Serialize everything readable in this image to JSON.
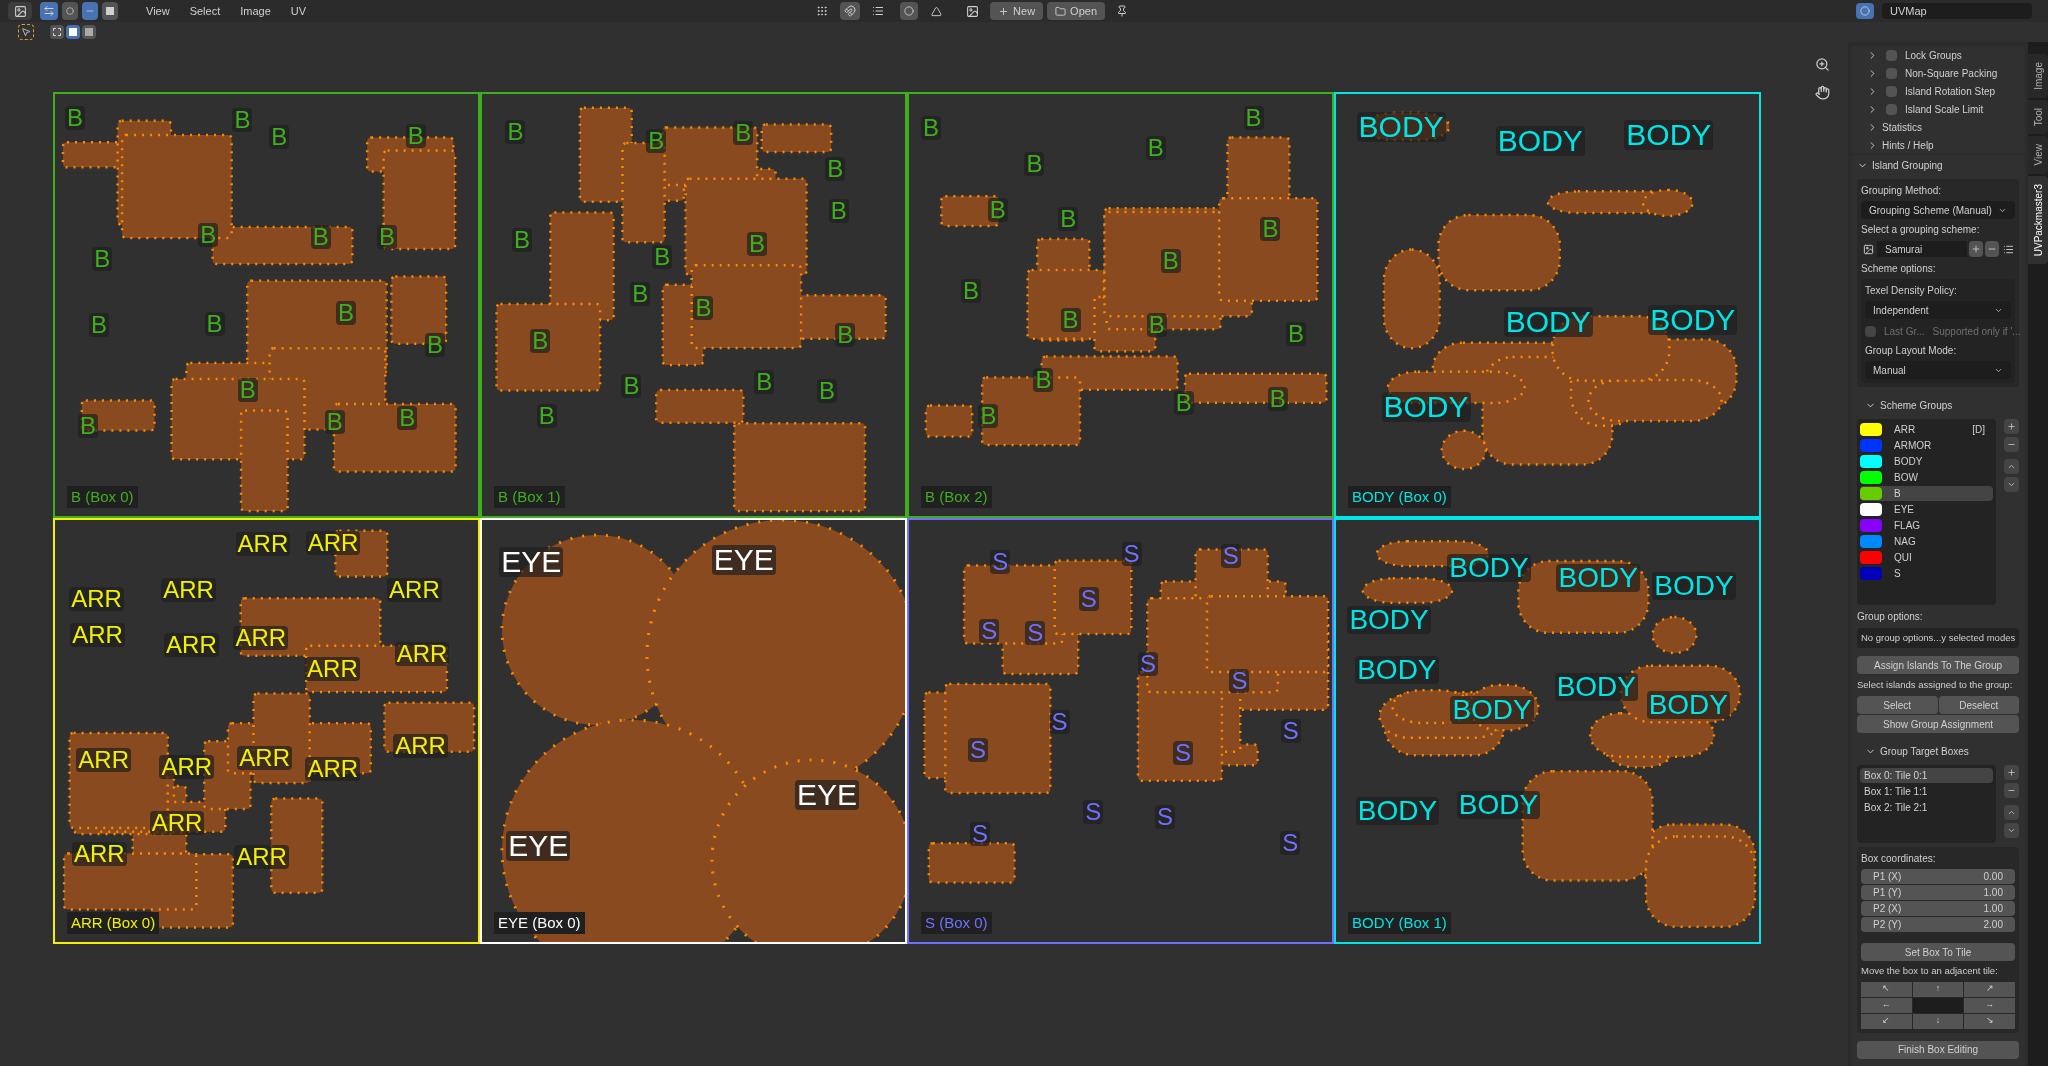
{
  "header": {
    "menus": [
      "View",
      "Select",
      "Image",
      "UV"
    ],
    "new_label": "New",
    "open_label": "Open",
    "uv_map": "UVMap"
  },
  "canvas": {
    "tiles": [
      {
        "box_label": "B (Box 0)",
        "color": "#3fae1f",
        "islands": [
          "B",
          "B",
          "B",
          "B",
          "B",
          "B",
          "B",
          "B",
          "B",
          "B",
          "B",
          "B",
          "B",
          "B",
          "B",
          "B"
        ]
      },
      {
        "box_label": "B (Box 1)",
        "color": "#3fae1f",
        "islands": [
          "B",
          "B",
          "B",
          "B",
          "B",
          "B",
          "B",
          "B",
          "B",
          "B",
          "B",
          "B",
          "B",
          "B",
          "B",
          "B"
        ]
      },
      {
        "box_label": "B (Box 2)",
        "color": "#3fae1f",
        "islands": [
          "B",
          "B",
          "B",
          "B",
          "B",
          "B",
          "B",
          "B",
          "B",
          "B",
          "B",
          "B",
          "B",
          "B",
          "B",
          "B"
        ]
      },
      {
        "box_label": "BODY (Box 0)",
        "color": "#00e5e5",
        "islands": [
          "BODY",
          "BODY",
          "BODY",
          "BODY",
          "BODY",
          "BODY"
        ]
      },
      {
        "box_label": "ARR (Box 0)",
        "color": "#f2f200",
        "islands": [
          "ARR",
          "ARR",
          "ARR",
          "ARR",
          "ARR",
          "ARR",
          "ARR",
          "ARR",
          "ARR",
          "ARR",
          "ARR",
          "ARR",
          "ARR",
          "ARR",
          "ARR",
          "ARR",
          "ARR",
          "ARR"
        ]
      },
      {
        "box_label": "EYE (Box 0)",
        "color": "#ffffff",
        "islands": [
          "EYE",
          "EYE",
          "EYE",
          "EYE"
        ]
      },
      {
        "box_label": "S (Box 0)",
        "color": "#7070ff",
        "islands": [
          "S",
          "S",
          "S",
          "S",
          "S",
          "S",
          "S",
          "S",
          "S",
          "S",
          "S",
          "S",
          "S",
          "S",
          "S",
          "S"
        ]
      },
      {
        "box_label": "BODY (Box 1)",
        "color": "#00e5e5",
        "islands": [
          "BODY",
          "BODY",
          "BODY",
          "BODY",
          "BODY",
          "BODY",
          "BODY",
          "BODY",
          "BODY",
          "BODY"
        ]
      }
    ]
  },
  "sidebar_tabs": [
    {
      "label": "Image",
      "selected": false
    },
    {
      "label": "Tool",
      "selected": false
    },
    {
      "label": "View",
      "selected": false
    },
    {
      "label": "UVPackmaster3",
      "selected": true
    }
  ],
  "options": [
    {
      "label": "Lock Groups",
      "checked": false
    },
    {
      "label": "Non-Square Packing",
      "checked": false
    },
    {
      "label": "Island Rotation Step",
      "checked": false
    },
    {
      "label": "Island Scale Limit",
      "checked": false
    }
  ],
  "subpanels": [
    {
      "label": "Statistics",
      "expanded": false
    },
    {
      "label": "Hints / Help",
      "expanded": false
    }
  ],
  "island_grouping": {
    "title": "Island Grouping",
    "expanded": true,
    "method_label": "Grouping Method:",
    "method": "Grouping Scheme (Manual)",
    "scheme_label": "Select a grouping scheme:",
    "scheme": "Samurai",
    "scheme_options_label": "Scheme options:",
    "texel_label": "Texel Density Policy:",
    "texel": "Independent",
    "last_group": {
      "label": "Last Gr...",
      "note": "Supported only if '...",
      "checked": false,
      "disabled": true
    },
    "layout_label": "Group Layout Mode:",
    "layout": "Manual"
  },
  "scheme_groups": {
    "title": "Scheme Groups",
    "expanded": true,
    "groups": [
      {
        "name": "ARR",
        "color": "#ffff00",
        "selected": false,
        "tag": "[D]"
      },
      {
        "name": "ARMOR",
        "color": "#0033ff",
        "selected": false
      },
      {
        "name": "BODY",
        "color": "#00ffff",
        "selected": false
      },
      {
        "name": "BOW",
        "color": "#00ff00",
        "selected": false
      },
      {
        "name": "B",
        "color": "#66cc00",
        "selected": true
      },
      {
        "name": "EYE",
        "color": "#ffffff",
        "selected": false
      },
      {
        "name": "FLAG",
        "color": "#8800ff",
        "selected": false
      },
      {
        "name": "NAG",
        "color": "#0088ff",
        "selected": false
      },
      {
        "name": "QUI",
        "color": "#ff0000",
        "selected": false
      },
      {
        "name": "S",
        "color": "#0000bb",
        "selected": false
      }
    ],
    "options_label": "Group options:",
    "options_note": "No group options...y selected modes",
    "assign_button": "Assign Islands To The Group",
    "select_label": "Select islands assigned to the group:",
    "select_button": "Select",
    "deselect_button": "Deselect",
    "show_button": "Show Group Assignment"
  },
  "target_boxes": {
    "title": "Group Target Boxes",
    "expanded": true,
    "boxes": [
      {
        "label": "Box 0: Tile 0:1",
        "selected": true
      },
      {
        "label": "Box 1: Tile 1:1",
        "selected": false
      },
      {
        "label": "Box 2: Tile 2:1",
        "selected": false
      }
    ],
    "coords_label": "Box coordinates:",
    "coords": [
      {
        "label": "P1 (X)",
        "value": "0.00"
      },
      {
        "label": "P1 (Y)",
        "value": "1.00"
      },
      {
        "label": "P2 (X)",
        "value": "1.00"
      },
      {
        "label": "P2 (Y)",
        "value": "2.00"
      }
    ],
    "set_button": "Set Box To Tile",
    "move_label": "Move the box to an adjacent tile:",
    "arrows": [
      "↖",
      "↑",
      "↗",
      "←",
      "→",
      "↙",
      "↓",
      "↘"
    ],
    "finish_button": "Finish Box Editing"
  }
}
